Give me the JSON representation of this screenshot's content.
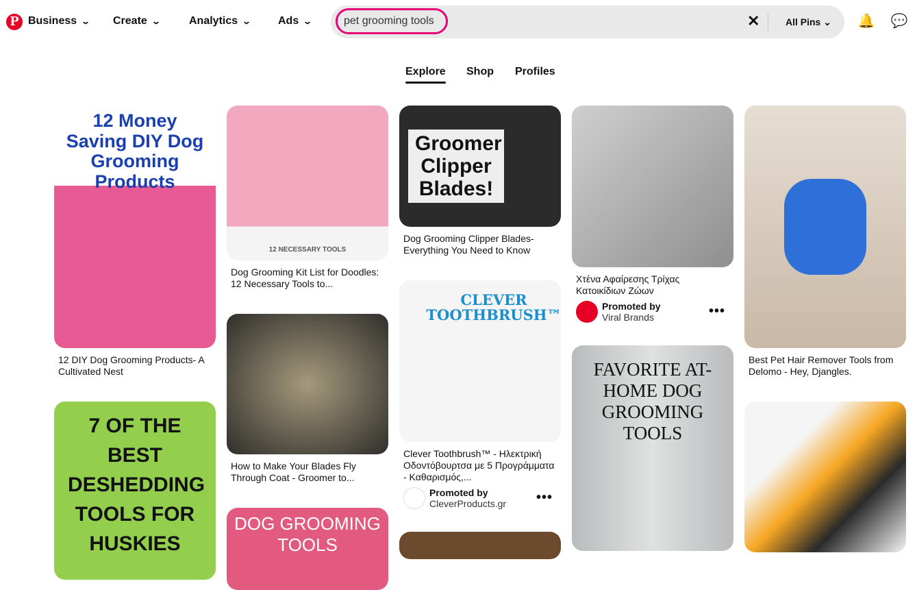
{
  "nav": {
    "logo": "P",
    "items": [
      {
        "label": "Business"
      },
      {
        "label": "Create"
      },
      {
        "label": "Analytics"
      },
      {
        "label": "Ads"
      }
    ]
  },
  "search": {
    "query": "pet grooming tools",
    "scope": "All Pins"
  },
  "tabs": [
    {
      "label": "Explore",
      "active": true
    },
    {
      "label": "Shop"
    },
    {
      "label": "Profiles"
    }
  ],
  "pins": [
    {
      "title": "12 DIY Dog Grooming Products- A Cultivated Nest",
      "image_text": "12 Money Saving DIY Dog Grooming Products"
    },
    {
      "title": "",
      "image_text": "7 OF THE BEST DESHEDDING TOOLS FOR HUSKIES"
    },
    {
      "title": "Dog Grooming Kit List for Doodles: 12 Necessary Tools to...",
      "image_text": "12 NECESSARY TOOLS"
    },
    {
      "title": "How to Make Your Blades Fly Through Coat - Groomer to...",
      "image_text": ""
    },
    {
      "title": "",
      "image_text": "DOG GROOMING TOOLS"
    },
    {
      "title": "Dog Grooming Clipper Blades- Everything You Need to Know",
      "image_text": "Groomer Clipper Blades!"
    },
    {
      "title": "Clever Toothbrush™ - Ηλεκτρική Οδοντόβουρτσα με 5 Προγράμματα - Καθαρισμός,...",
      "image_text": "CLEVER TOOTHBRUSH™",
      "promoted_by": "Promoted by",
      "advertiser": "CleverProducts.gr"
    },
    {
      "title": "Χτένα Αφαίρεσης Τρίχας Κατοικίδιων Ζώων",
      "image_text": "",
      "promoted_by": "Promoted by",
      "advertiser": "Viral Brands"
    },
    {
      "title": "",
      "image_text": "FAVORITE AT-HOME DOG GROOMING TOOLS"
    },
    {
      "title": "Best Pet Hair Remover Tools from Delomo - Hey, Djangles.",
      "image_text": ""
    },
    {
      "title": "",
      "image_text": ""
    }
  ],
  "more_label": "•••"
}
